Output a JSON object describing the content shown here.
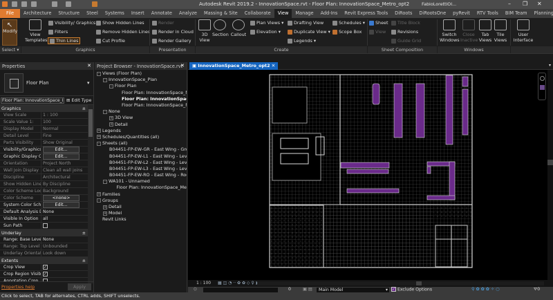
{
  "titlebar": {
    "title": "Autodesk Revit 2019.2 - InnovationSpace.rvt - Floor Plan: InnovationSpace_Metro_opt2",
    "user": "FabioLorettiOl..."
  },
  "tabs": [
    "File",
    "Architecture",
    "Structure",
    "Steel",
    "Systems",
    "Insert",
    "Annotate",
    "Analyze",
    "Massing & Site",
    "Collaborate",
    "View",
    "Manage",
    "Add-Ins",
    "Revit Express Tools",
    "DiRoots",
    "DiRootsOne",
    "pyRevit",
    "RTV Tools",
    "BIM Team",
    "Planning",
    "Modify"
  ],
  "active_tab": "View",
  "ribbon": {
    "modify": "Modify",
    "select": "Select",
    "view_templates": "View Templates",
    "visibility_graphics": "Visibility/ Graphics",
    "filters": "Filters",
    "thin_lines": "Thin Lines",
    "show_hidden_lines": "Show Hidden Lines",
    "remove_hidden_lines": "Remove Hidden Lines",
    "cut_profile": "Cut Profile",
    "graphics": "Graphics",
    "render": "Render",
    "render_cloud": "Render in Cloud",
    "render_gallery": "Render Gallery",
    "presentation": "Presentation",
    "view_3d": "3D View",
    "section": "Section",
    "callout": "Callout",
    "plan_views": "Plan Views",
    "elevation": "Elevation",
    "drafting_view": "Drafting View",
    "duplicate_view": "Duplicate View",
    "legends": "Legends",
    "schedules": "Schedules",
    "scope_box": "Scope Box",
    "create": "Create",
    "sheet": "Sheet",
    "view": "View",
    "title_block": "Title Block",
    "revisions": "Revisions",
    "guide_grid": "Guide Grid",
    "sheet_composition": "Sheet Composition",
    "switch_windows": "Switch Windows",
    "close_inactive": "Close Inactive",
    "tab_views": "Tab Views",
    "tile_views": "Tile Views",
    "windows": "Windows",
    "user_interface": "User Interface"
  },
  "properties": {
    "title": "Properties",
    "type": "Floor Plan",
    "instance": "Floor Plan: InnovationSpace_I",
    "edit_type": "Edit Type",
    "sections": [
      {
        "name": "Graphics",
        "rows": [
          {
            "k": "View Scale",
            "v": "1 : 100",
            "dim": true
          },
          {
            "k": "Scale Value    1:",
            "v": "100",
            "dim": true
          },
          {
            "k": "Display Model",
            "v": "Normal",
            "dim": true
          },
          {
            "k": "Detail Level",
            "v": "Fine",
            "dim": true
          },
          {
            "k": "Parts Visibility",
            "v": "Show Original",
            "dim": true
          },
          {
            "k": "Visibility/Graphics...",
            "v": "Edit...",
            "btn": true
          },
          {
            "k": "Graphic Display O...",
            "v": "Edit...",
            "btn": true
          },
          {
            "k": "Orientation",
            "v": "Project North",
            "dim": true
          },
          {
            "k": "Wall Join Display",
            "v": "Clean all wall joins",
            "dim": true
          },
          {
            "k": "Discipline",
            "v": "Architectural",
            "dim": true
          },
          {
            "k": "Show Hidden Lines",
            "v": "By Discipline",
            "dim": true
          },
          {
            "k": "Color Scheme Loc...",
            "v": "Background",
            "dim": true
          },
          {
            "k": "Color Scheme",
            "v": "<none>",
            "btn": true,
            "dim": true
          },
          {
            "k": "System Color Sche...",
            "v": "Edit...",
            "btn": true
          },
          {
            "k": "Default Analysis D...",
            "v": "None"
          },
          {
            "k": "Visible In Option",
            "v": "all"
          },
          {
            "k": "Sun Path",
            "v": "",
            "check": false
          }
        ]
      },
      {
        "name": "Underlay",
        "rows": [
          {
            "k": "Range: Base Level",
            "v": "None"
          },
          {
            "k": "Range: Top Level",
            "v": "Unbounded",
            "dim": true
          },
          {
            "k": "Underlay Orientati...",
            "v": "Look down",
            "dim": true
          }
        ]
      },
      {
        "name": "Extents",
        "rows": [
          {
            "k": "Crop View",
            "v": "",
            "check": true
          },
          {
            "k": "Crop Region Visible",
            "v": "",
            "check": true
          },
          {
            "k": "Annotation Crop",
            "v": "",
            "check": false
          }
        ]
      }
    ],
    "help": "Properties help",
    "apply": "Apply"
  },
  "browser": {
    "title": "Project Browser - InnovationSpace.rvt",
    "items": [
      {
        "t": "Views (Floor Plan)",
        "l": 0,
        "ex": "-"
      },
      {
        "t": "InnovationSpace_Plan",
        "l": 1,
        "ex": "-"
      },
      {
        "t": "Floor Plan",
        "l": 2,
        "ex": "-"
      },
      {
        "t": "Floor Plan: InnovationSpace_Me",
        "l": 4
      },
      {
        "t": "Floor Plan: InnovationSpace_M",
        "l": 4,
        "bold": true
      },
      {
        "t": "Floor Plan: InnovationSpace_Me",
        "l": 4
      },
      {
        "t": "None",
        "l": 1,
        "ex": "-"
      },
      {
        "t": "3D View",
        "l": 2,
        "ex": "+"
      },
      {
        "t": "Detail",
        "l": 2,
        "ex": "+"
      },
      {
        "t": "Legends",
        "l": 0,
        "ex": "+"
      },
      {
        "t": "Schedules/Quantities (all)",
        "l": 0,
        "ex": "+"
      },
      {
        "t": "Sheets (all)",
        "l": 0,
        "ex": "-"
      },
      {
        "t": "B04451-FP-EW-GR - East Wing - Ground",
        "l": 2
      },
      {
        "t": "B04451-FP-EW-L1 - East Wing - Level 1",
        "l": 2
      },
      {
        "t": "B04451-FP-EW-L2 - East Wing - Level 2",
        "l": 2
      },
      {
        "t": "B04451-FP-EW-L3 - East Wing - Level 3",
        "l": 2
      },
      {
        "t": "B04451-FP-EW-RO - East Wing - Roof",
        "l": 2
      },
      {
        "t": "WA101 - Unnamed",
        "l": 1,
        "ex": "-"
      },
      {
        "t": "Floor Plan: InnovationSpace_Me",
        "l": 3
      },
      {
        "t": "Families",
        "l": 0,
        "ex": "+"
      },
      {
        "t": "Groups",
        "l": 0,
        "ex": "-"
      },
      {
        "t": "Detail",
        "l": 1,
        "ex": "+"
      },
      {
        "t": "Model",
        "l": 1,
        "ex": "+"
      },
      {
        "t": "Revit Links",
        "l": 0
      }
    ]
  },
  "view": {
    "tab": "InnovationSpace_Metro_opt2",
    "scale": "1 : 100"
  },
  "statusbar": {
    "hint": "Click to select, TAB for alternates, CTRL adds, SHIFT unselects.",
    "worksets": "0",
    "model": "Main Model",
    "exclude_options": "Exclude Options",
    "filter_count": "0"
  },
  "colors": {
    "accent": "#e07b30",
    "viewtab": "#1565c0",
    "furniture": "#6a2a8a"
  }
}
